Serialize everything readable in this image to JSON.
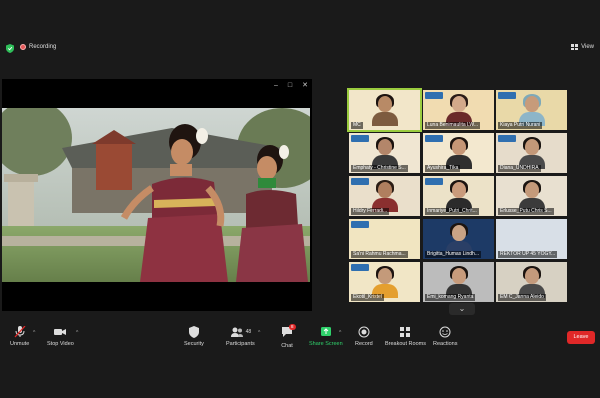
{
  "top": {
    "recording_label": "Recording",
    "view_label": "View"
  },
  "share": {
    "controls": [
      "–",
      "□",
      "✕"
    ]
  },
  "participants": [
    {
      "name": "MC",
      "bg": "#f2e6c9",
      "skin": "#b88a66",
      "shirt": "#7d5b3f",
      "hair": "#1d1410",
      "active": true
    },
    {
      "name": "Luna Benimaulita LW...",
      "bg": "#f1dcb1",
      "skin": "#d3a98a",
      "shirt": "#6b2a2a",
      "hair": "#2a1b16",
      "active": false
    },
    {
      "name": "Kiaya Putri Nurani",
      "bg": "#e9d9a8",
      "skin": "#c79b7a",
      "shirt": "#8db5c8",
      "hair": "#7ea9b8",
      "active": false
    },
    {
      "name": "Emphaty - Christine S...",
      "bg": "#f0e6d2",
      "skin": "#b3866a",
      "shirt": "#3a3a3a",
      "hair": "#1a120e",
      "active": false
    },
    {
      "name": "Ayushira_Tika",
      "bg": "#f3e8cf",
      "skin": "#c59676",
      "shirt": "#2f2f2f",
      "hair": "#1d1410",
      "active": false
    },
    {
      "name": "Diana_UNDHIRA",
      "bg": "#e6dccb",
      "skin": "#c39878",
      "shirt": "#4a4a4a",
      "hair": "#1a1410",
      "active": false
    },
    {
      "name": "Hildry Ferradi...",
      "bg": "#eadfcb",
      "skin": "#b07f5f",
      "shirt": "#8a2f2f",
      "hair": "#2a1c14",
      "active": false
    },
    {
      "name": "Inmariye_Putri_Chrit...",
      "bg": "#ece2c8",
      "skin": "#c99b7c",
      "shirt": "#2b2b2b",
      "hair": "#1b1310",
      "active": false
    },
    {
      "name": "Erlusse_Putu Chris S...",
      "bg": "#e8e0d0",
      "skin": "#c49a7a",
      "shirt": "#3b3b3b",
      "hair": "#1b1511",
      "active": false
    },
    {
      "name": "Sa'ni Rahmu Rachma...",
      "bg": "#f1e5c1",
      "skin": "#c7a07f",
      "shirt": "#5a4a3a",
      "hair": "#2a1f16",
      "active": false
    },
    {
      "name": "Brigitta_Humas Lindh...",
      "bg": "#1d3a66",
      "skin": "#c9a385",
      "shirt": "#2a3f66",
      "hair": "#1d1410",
      "active": false
    },
    {
      "name": "REKTOR UP 45 YOGY...",
      "bg": "#d8dfe7",
      "skin": "#c29b7b",
      "shirt": "#3a3a3a",
      "hair": "#1a1410",
      "active": false
    },
    {
      "name": "Ekotil_Kristel",
      "bg": "#f1e6c6",
      "skin": "#c49a7a",
      "shirt": "#e49f2f",
      "hair": "#1d1410",
      "active": false
    },
    {
      "name": "Emi_komang Ryanta",
      "bg": "#bcbcbc",
      "skin": "#c79b7b",
      "shirt": "#343434",
      "hair": "#1b1410",
      "active": false
    },
    {
      "name": "EM C_Janna Aleido",
      "bg": "#d7d1c3",
      "skin": "#c39a7c",
      "shirt": "#4a4a4a",
      "hair": "#1b1410",
      "active": false
    }
  ],
  "toolbar": {
    "unmute": "Unmute",
    "stop_video": "Stop Video",
    "security": "Security",
    "participants": "Participants",
    "participants_count": "48",
    "chat": "Chat",
    "chat_badge": "8",
    "share_screen": "Share Screen",
    "record": "Record",
    "breakout": "Breakout Rooms",
    "reactions": "Reactions",
    "leave": "Leave"
  },
  "colors": {
    "accent_green": "#2fd16b",
    "leave_red": "#e02828",
    "active_outline": "#9bcc3f"
  }
}
